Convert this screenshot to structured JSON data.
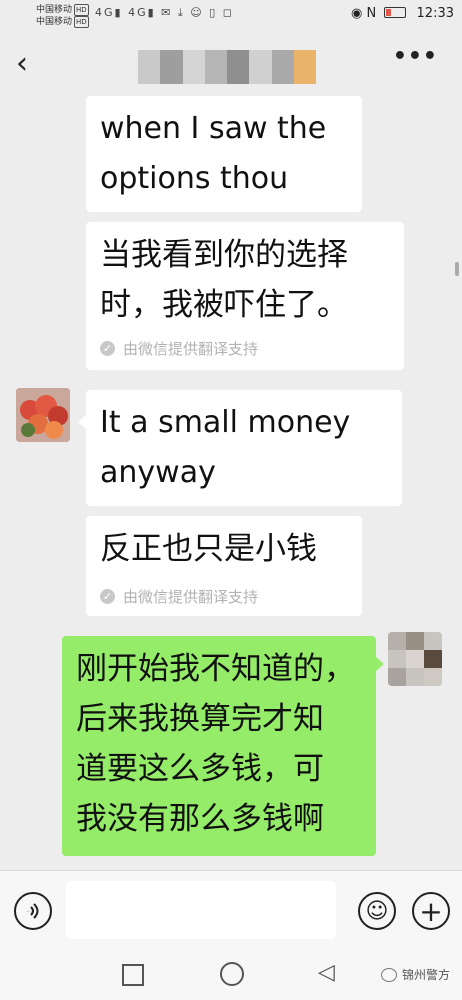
{
  "status_bar": {
    "carrier1": "中国移动",
    "carrier2": "中国移动",
    "hd": "HD",
    "net": "4G",
    "time": "12:33"
  },
  "nav": {
    "back_icon": "chevron-left-icon",
    "more_label": "•••"
  },
  "messages": [
    {
      "side": "left",
      "text_lines": [
        "when I saw the",
        "options thou"
      ]
    },
    {
      "side": "left",
      "text_lines": [
        "当我看到你的选择",
        "时，我被吓住了。"
      ],
      "translation_note": "由微信提供翻译支持"
    },
    {
      "side": "left",
      "text_lines": [
        "It a small money",
        "anyway"
      ]
    },
    {
      "side": "left",
      "text_lines": [
        "反正也只是小钱"
      ],
      "translation_note": "由微信提供翻译支持"
    },
    {
      "side": "right",
      "text_lines": [
        "刚开始我不知道的，",
        "后来我换算完才知",
        "道要这么多钱，可",
        "我没有那么多钱啊"
      ]
    }
  ],
  "input_bar": {
    "voice_icon": "voice-icon",
    "emoji_icon": "emoji-icon",
    "plus_icon": "plus-icon",
    "value": ""
  },
  "watermark": {
    "text": "锦州警方"
  },
  "colors": {
    "bubble_green": "#95ec69",
    "background": "#ededed"
  }
}
